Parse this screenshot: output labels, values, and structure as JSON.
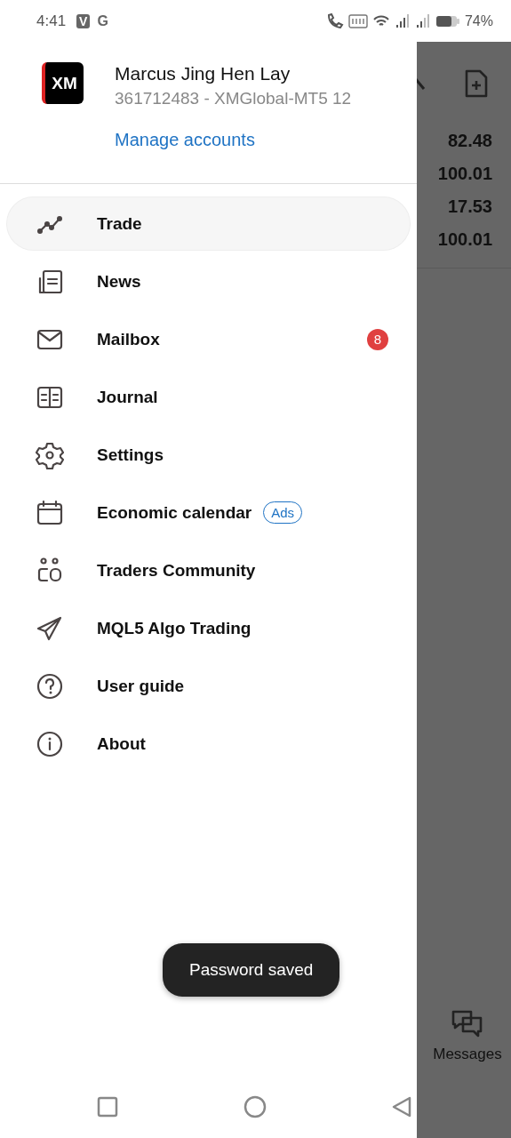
{
  "status_bar": {
    "time": "4:41",
    "notification_letters": [
      "V",
      "G"
    ],
    "battery": "74%"
  },
  "account": {
    "logo": "XM",
    "name": "Marcus Jing Hen Lay",
    "server": "361712483 - XMGlobal-MT5 12",
    "manage_link": "Manage accounts"
  },
  "menu": [
    {
      "label": "Trade",
      "selected": true
    },
    {
      "label": "News",
      "selected": false
    },
    {
      "label": "Mailbox",
      "selected": false,
      "badge": "8"
    },
    {
      "label": "Journal",
      "selected": false
    },
    {
      "label": "Settings",
      "selected": false
    },
    {
      "label": "Economic calendar",
      "selected": false,
      "tag": "Ads"
    },
    {
      "label": "Traders Community",
      "selected": false
    },
    {
      "label": "MQL5 Algo Trading",
      "selected": false
    },
    {
      "label": "User guide",
      "selected": false
    },
    {
      "label": "About",
      "selected": false
    }
  ],
  "background": {
    "values": [
      "82.48",
      "100.01",
      "17.53",
      "100.01"
    ],
    "tab": "Messages"
  },
  "toast": "Password saved"
}
